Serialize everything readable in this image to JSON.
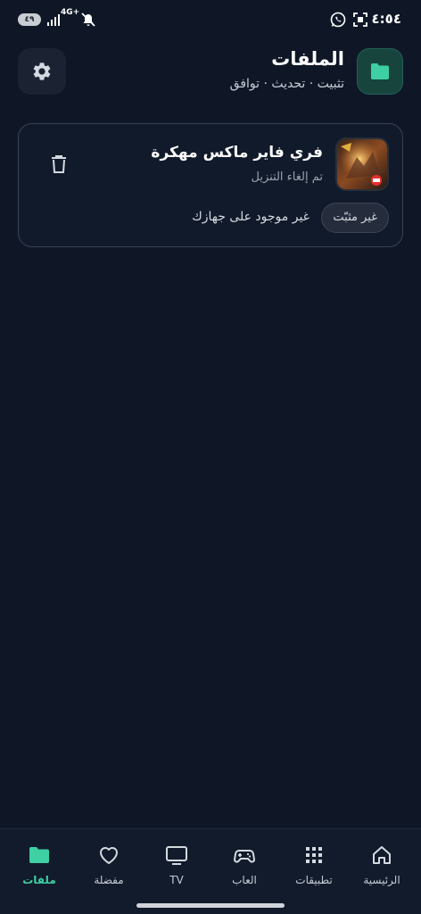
{
  "status_bar": {
    "time": "٤:٥٤",
    "battery": "٤٩",
    "network": "4G+"
  },
  "header": {
    "title": "الملفات",
    "subtitle": "تثبيت · تحديث · توافق",
    "icon": "folder-icon",
    "settings_icon": "gear-icon"
  },
  "files": [
    {
      "title": "فري فاير ماكس مهكرة",
      "status": "تم إلغاء التنزيل",
      "badge": "غير مثبّت",
      "note": "غير موجود على جهازك"
    }
  ],
  "nav": {
    "items": [
      {
        "label": "الرئيسية",
        "icon": "home-icon",
        "active": false
      },
      {
        "label": "تطبيقات",
        "icon": "grid-icon",
        "active": false
      },
      {
        "label": "العاب",
        "icon": "gamepad-icon",
        "active": false
      },
      {
        "label": "TV",
        "icon": "tv-icon",
        "active": false
      },
      {
        "label": "مفضلة",
        "icon": "heart-icon",
        "active": false
      },
      {
        "label": "ملفات",
        "icon": "folder-icon",
        "active": true
      }
    ]
  },
  "colors": {
    "background": "#0f1727",
    "accent": "#3ecfa2",
    "card_border": "#3a4254"
  }
}
